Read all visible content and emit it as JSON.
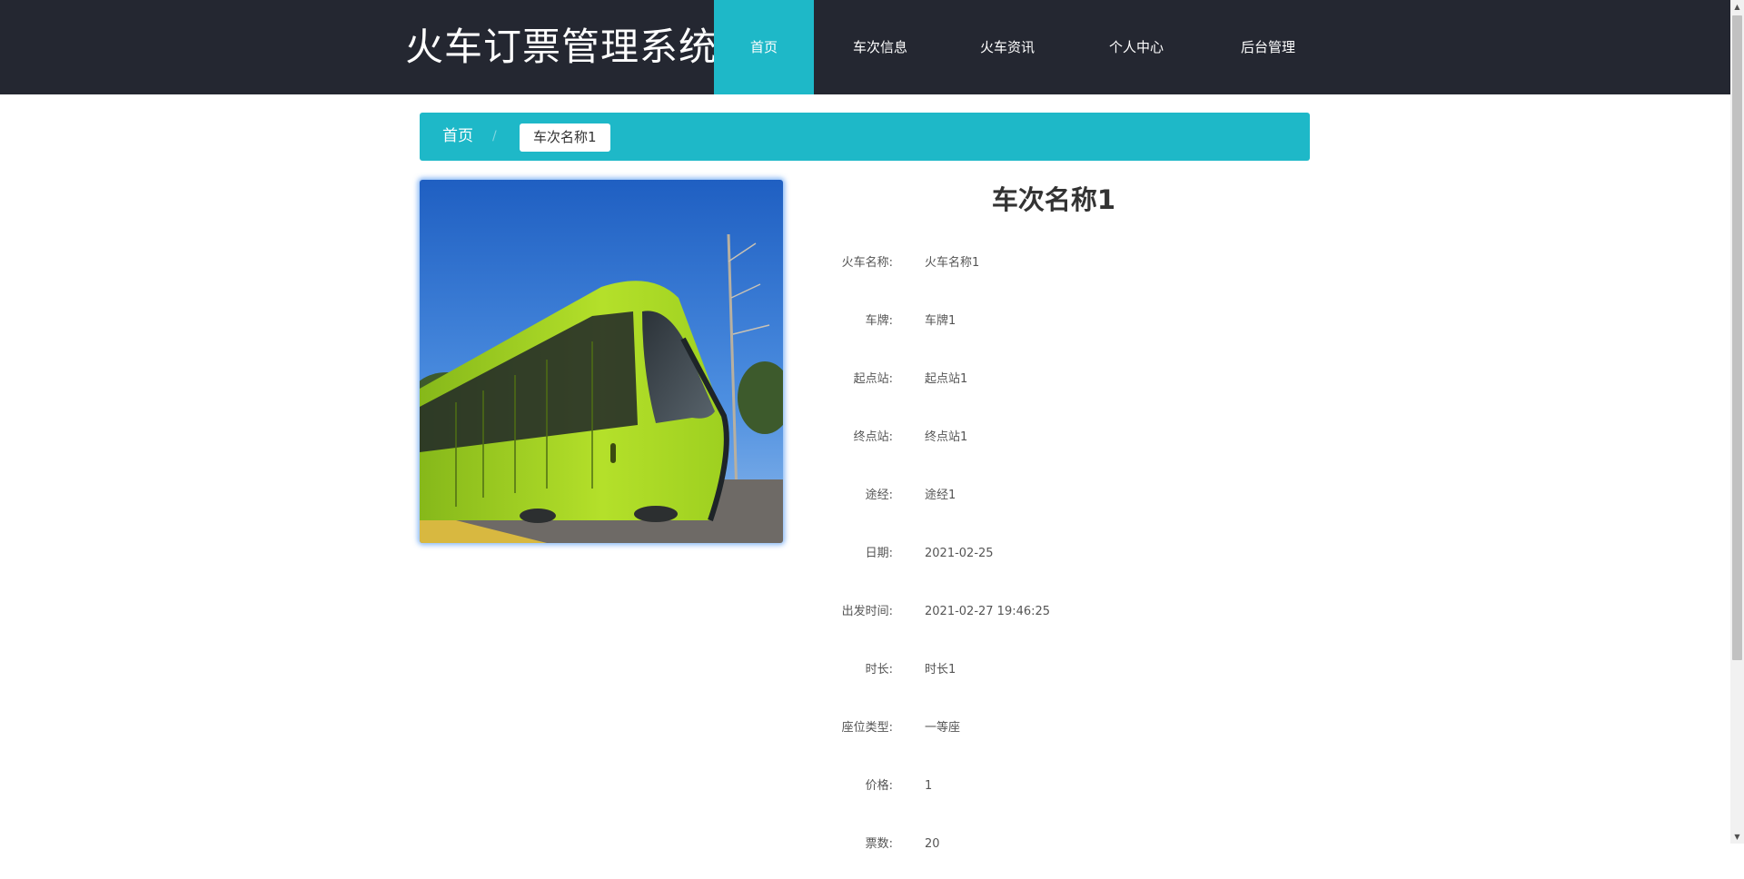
{
  "header": {
    "logo": "火车订票管理系统",
    "nav": [
      {
        "label": "首页",
        "active": true
      },
      {
        "label": "车次信息",
        "active": false
      },
      {
        "label": "火车资讯",
        "active": false
      },
      {
        "label": "个人中心",
        "active": false
      },
      {
        "label": "后台管理",
        "active": false
      }
    ]
  },
  "breadcrumb": {
    "home": "首页",
    "separator": "/",
    "current": "车次名称1"
  },
  "detail": {
    "title": "车次名称1",
    "fields": [
      {
        "label": "火车名称:",
        "value": "火车名称1"
      },
      {
        "label": "车牌:",
        "value": "车牌1"
      },
      {
        "label": "起点站:",
        "value": "起点站1"
      },
      {
        "label": "终点站:",
        "value": "终点站1"
      },
      {
        "label": "途经:",
        "value": "途经1"
      },
      {
        "label": "日期:",
        "value": "2021-02-25"
      },
      {
        "label": "出发时间:",
        "value": "2021-02-27 19:46:25"
      },
      {
        "label": "时长:",
        "value": "时长1"
      },
      {
        "label": "座位类型:",
        "value": "一等座"
      },
      {
        "label": "价格:",
        "value": "1"
      },
      {
        "label": "票数:",
        "value": "20"
      }
    ]
  },
  "colors": {
    "header_bg": "#242731",
    "accent": "#1eb8c8",
    "train_body": "#a8d820"
  },
  "image": {
    "subject": "green-tram-photo"
  }
}
